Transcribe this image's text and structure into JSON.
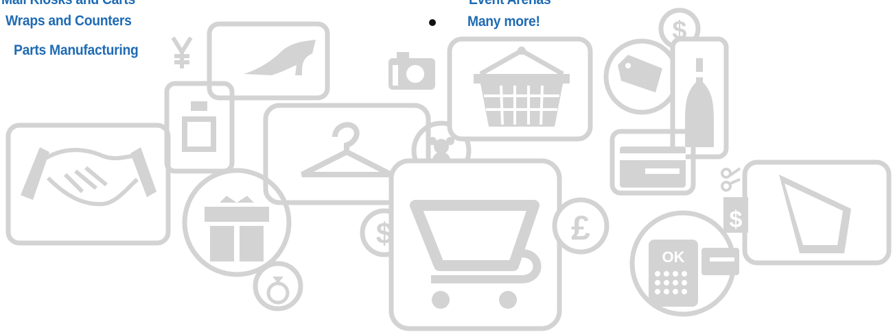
{
  "left_list": {
    "items": [
      "Mall Kiosks and Carts",
      "Wraps and Counters",
      "Parts Manufacturing"
    ]
  },
  "right_list": {
    "items": [
      "Event Arenas",
      "Many more!"
    ]
  },
  "icons": [
    "handshake-icon",
    "perfume-bottle-icon",
    "shoe-icon",
    "yen-sign-icon",
    "clothes-hanger-icon",
    "teddy-bear-icon",
    "gift-icon",
    "ring-icon",
    "dollar-coin-icon",
    "shopping-cart-icon",
    "pound-coin-icon",
    "camera-icon",
    "shopping-basket-icon",
    "dollar-coin-icon",
    "price-tag-icon",
    "wine-bottle-icon",
    "credit-card-icon",
    "scissors-coupon-icon",
    "tablet-icon",
    "calculator-icon"
  ],
  "colors": {
    "text": "#1f6bb3",
    "bullet": "#111111",
    "icon_gray": "#d3d3d3",
    "background": "#ffffff"
  }
}
